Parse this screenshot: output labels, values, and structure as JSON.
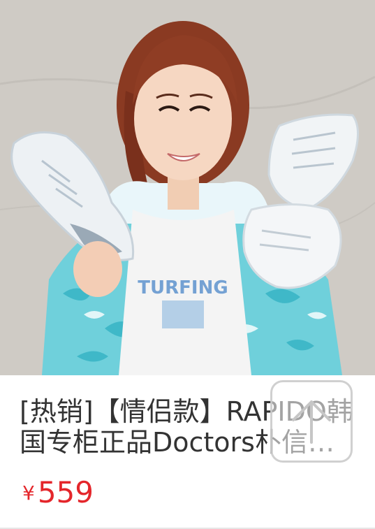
{
  "product": {
    "image_alt": "product photo: woman holding white sneakers",
    "title": "[热销]【情侣款】RAPIDO韩国专柜正品Doctors朴信惠同款运动鞋",
    "currency_symbol": "¥",
    "price": "559",
    "price_color": "#e4262b"
  },
  "back_to_top": {
    "icon": "arrow-up-icon"
  }
}
